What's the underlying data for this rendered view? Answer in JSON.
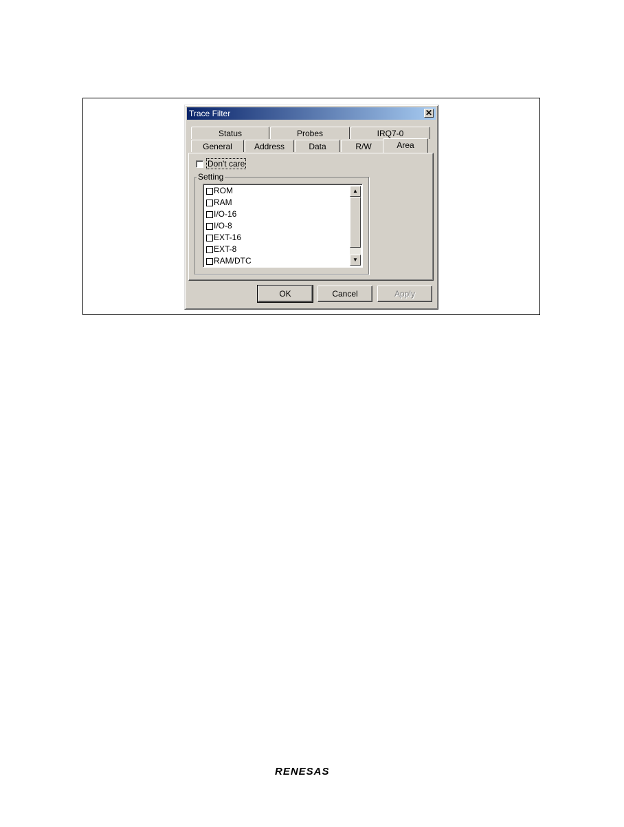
{
  "dialog": {
    "title": "Trace Filter",
    "close_symbol": "✕",
    "tabs_row_back": [
      "Status",
      "Probes",
      "IRQ7-0"
    ],
    "tabs_row_front": [
      "General",
      "Address",
      "Data",
      "R/W",
      "Area"
    ],
    "active_tab": "Area"
  },
  "area_tab": {
    "dont_care_label": "Don't care",
    "dont_care_checked": false,
    "group_label": "Setting",
    "list_items": [
      "ROM",
      "RAM",
      "I/O-16",
      "I/O-8",
      "EXT-16",
      "EXT-8",
      "RAM/DTC"
    ],
    "scroll_up_symbol": "▲",
    "scroll_down_symbol": "▼"
  },
  "buttons": {
    "ok": "OK",
    "cancel": "Cancel",
    "apply": "Apply"
  },
  "footer": {
    "logo_text": "RENESAS"
  }
}
